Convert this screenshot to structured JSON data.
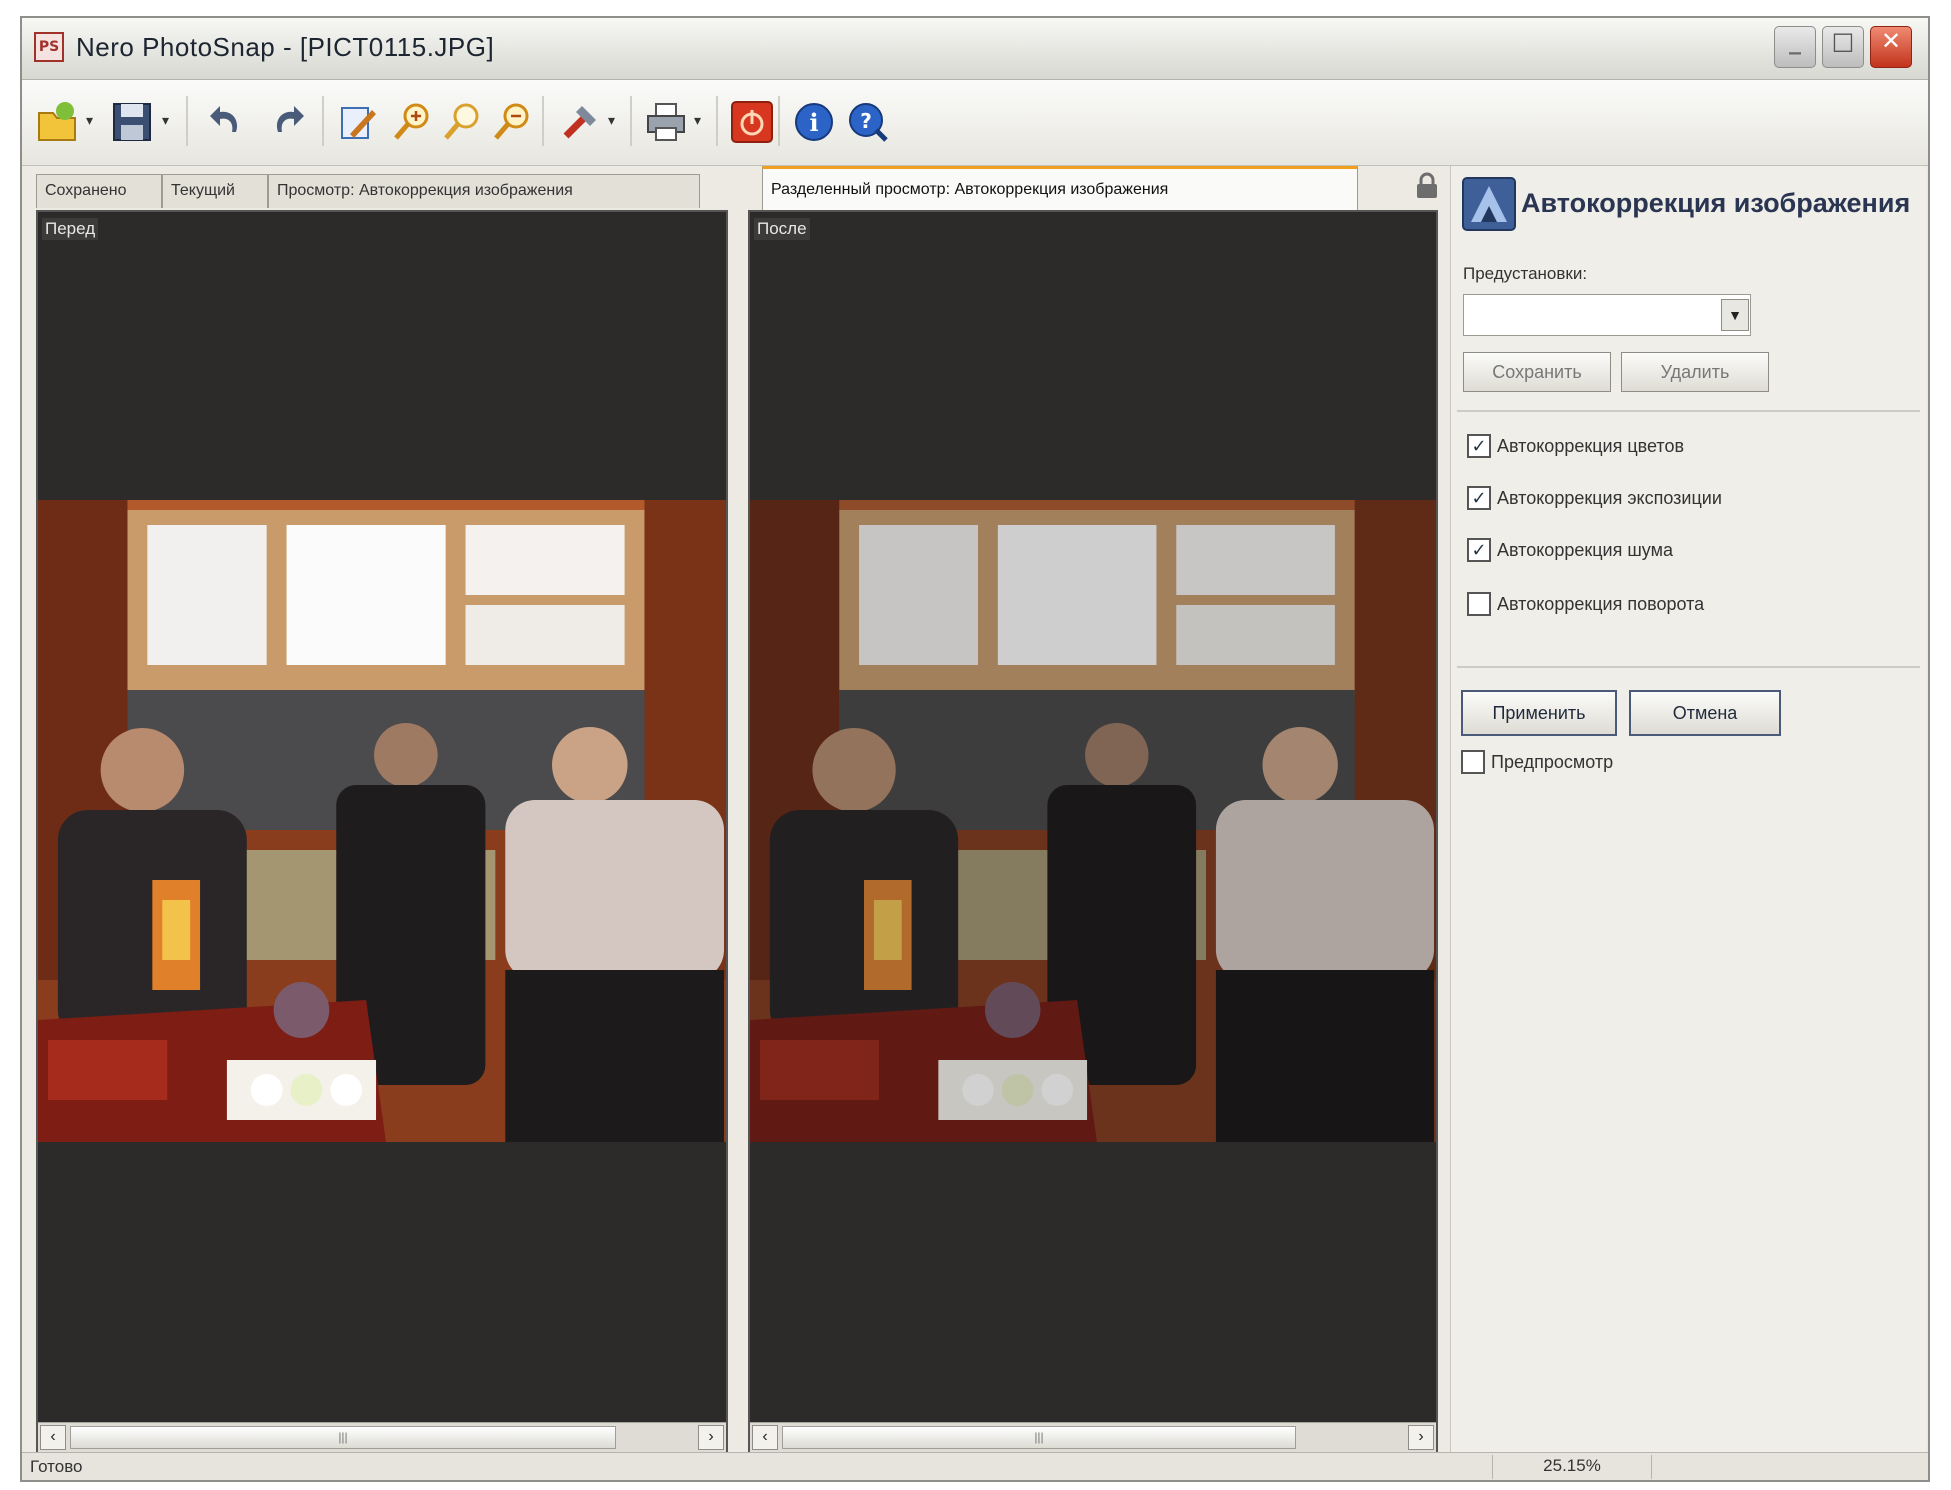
{
  "window": {
    "title": "Nero PhotoSnap - [PICT0115.JPG]",
    "controls": {
      "minimize": "_",
      "maximize": "□",
      "close": "✕"
    }
  },
  "toolbar": {
    "buttons": [
      {
        "name": "open-icon"
      },
      {
        "name": "save-icon"
      },
      {
        "name": "undo-icon"
      },
      {
        "name": "redo-icon"
      },
      {
        "name": "crop-icon"
      },
      {
        "name": "zoom-in-icon"
      },
      {
        "name": "zoom-icon"
      },
      {
        "name": "zoom-out-icon"
      },
      {
        "name": "tools-icon"
      },
      {
        "name": "print-icon"
      },
      {
        "name": "power-icon"
      },
      {
        "name": "info-icon"
      },
      {
        "name": "help-icon"
      }
    ]
  },
  "tabs": [
    {
      "label": "Сохранено",
      "active": false
    },
    {
      "label": "Текущий",
      "active": false
    },
    {
      "label": "Просмотр: Автокоррекция изображения",
      "active": false
    },
    {
      "label": "Разделенный просмотр: Автокоррекция изображения",
      "active": true
    }
  ],
  "panes": {
    "before_label": "Перед",
    "after_label": "После"
  },
  "panel": {
    "title": "Автокоррекция изображения",
    "presets_label": "Предустановки:",
    "presets_value": "",
    "save_button": "Сохранить",
    "delete_button": "Удалить",
    "options": [
      {
        "label": "Автокоррекция цветов",
        "checked": true
      },
      {
        "label": "Автокоррекция экспозиции",
        "checked": true
      },
      {
        "label": "Автокоррекция шума",
        "checked": true
      },
      {
        "label": "Автокоррекция поворота",
        "checked": false
      }
    ],
    "apply_button": "Применить",
    "cancel_button": "Отмена",
    "preview_label": "Предпросмотр",
    "preview_checked": false
  },
  "status": {
    "text": "Готово",
    "zoom": "25.15%"
  },
  "colors": {
    "accent_tab": "#f0a020",
    "pane_background": "#2d2a2a",
    "panel_title": "#2a3552"
  }
}
